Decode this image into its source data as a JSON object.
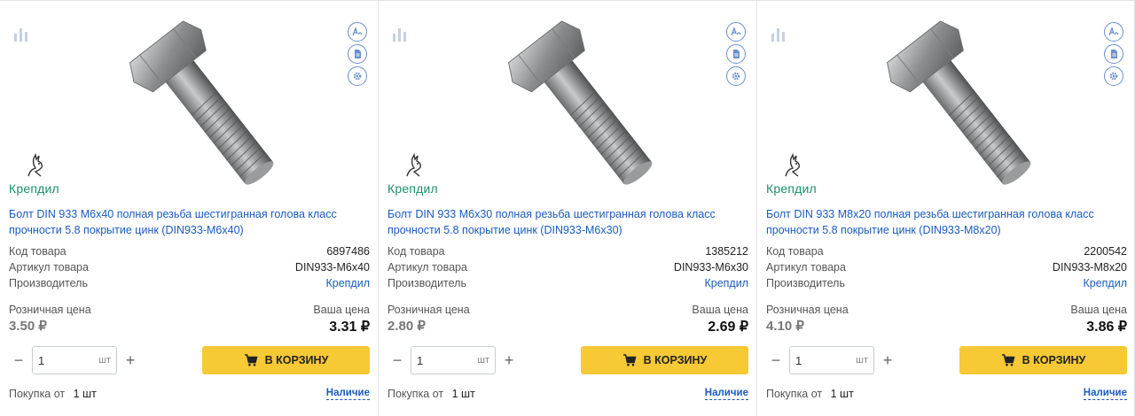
{
  "products": [
    {
      "title": "Болт DIN 933 М6х40 полная резьба шестигранная голова класс прочности 5.8 покрытие цинк (DIN933-M6x40)",
      "code_label": "Код товара",
      "code": "6897486",
      "article_label": "Артикул товара",
      "article": "DIN933-M6x40",
      "maker_label": "Производитель",
      "maker": "Крепдил",
      "retail_label": "Розничная цена",
      "retail_price": "3.50 ₽",
      "your_label": "Ваша цена",
      "your_price": "3.31 ₽",
      "qty_value": "1",
      "qty_unit": "шт",
      "minus": "−",
      "plus": "+",
      "cart_label": "В КОРЗИНУ",
      "min_label": "Покупка от",
      "min_value": "1 шт",
      "stock_label": "Наличие",
      "brand": "Крепдил"
    },
    {
      "title": "Болт DIN 933 М6х30 полная резьба шестигранная голова класс прочности 5.8 покрытие цинк (DIN933-M6x30)",
      "code_label": "Код товара",
      "code": "1385212",
      "article_label": "Артикул товара",
      "article": "DIN933-M6x30",
      "maker_label": "Производитель",
      "maker": "Крепдил",
      "retail_label": "Розничная цена",
      "retail_price": "2.80 ₽",
      "your_label": "Ваша цена",
      "your_price": "2.69 ₽",
      "qty_value": "1",
      "qty_unit": "шт",
      "minus": "−",
      "plus": "+",
      "cart_label": "В КОРЗИНУ",
      "min_label": "Покупка от",
      "min_value": "1 шт",
      "stock_label": "Наличие",
      "brand": "Крепдил"
    },
    {
      "title": "Болт DIN 933 М8х20 полная резьба шестигранная голова класс прочности 5.8 покрытие цинк (DIN933-M8x20)",
      "code_label": "Код товара",
      "code": "2200542",
      "article_label": "Артикул товара",
      "article": "DIN933-M8x20",
      "maker_label": "Производитель",
      "maker": "Крепдил",
      "retail_label": "Розничная цена",
      "retail_price": "4.10 ₽",
      "your_label": "Ваша цена",
      "your_price": "3.86 ₽",
      "qty_value": "1",
      "qty_unit": "шт",
      "minus": "−",
      "plus": "+",
      "cart_label": "В КОРЗИНУ",
      "min_label": "Покупка от",
      "min_value": "1 шт",
      "stock_label": "Наличие",
      "brand": "Крепдил"
    }
  ],
  "icons": {
    "compare": "bar-chart-icon",
    "analog": "analog-icon",
    "document": "document-icon",
    "settings": "gear-icon",
    "cart": "cart-icon"
  },
  "colors": {
    "accent_link": "#1a5bbf",
    "cart_button": "#f6c935",
    "brand_green": "#1a8f6b",
    "icon_blue": "#6b8fc9"
  }
}
